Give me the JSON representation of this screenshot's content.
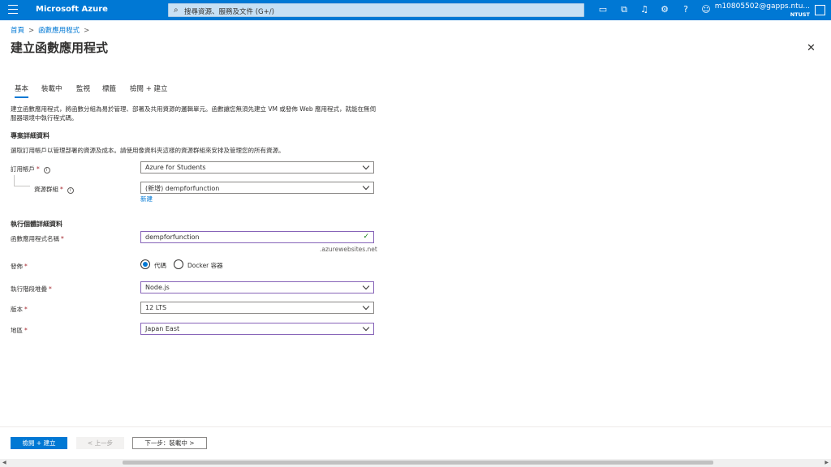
{
  "topbar": {
    "brand": "Microsoft Azure",
    "search_placeholder": "搜尋資源、服務及文件 (G+/)",
    "account_email": "m10805502@gapps.ntu...",
    "account_org": "NTUST"
  },
  "breadcrumb": {
    "home": "首頁",
    "current": "函數應用程式"
  },
  "page_title": "建立函數應用程式",
  "tabs": [
    "基本",
    "裝載中",
    "監視",
    "標籤",
    "檢閱 + 建立"
  ],
  "description": "建立函數應用程式，將函數分組為易於管理、部署及共用資源的邏輯單元。函數讓您無須先建立 VM 或發佈 Web 應用程式，就能在無伺服器環境中執行程式碼。",
  "project": {
    "heading": "專案詳細資料",
    "desc": "選取訂用帳戶以管理部署的資源及成本。請使用像資料夾這樣的資源群組來安排及管理您的所有資源。",
    "subscription_label": "訂用帳戶",
    "subscription_value": "Azure for Students",
    "resource_group_label": "資源群組",
    "resource_group_value": "(新增) dempforfunction",
    "new_link": "新建"
  },
  "instance": {
    "heading": "執行個體詳細資料",
    "name_label": "函數應用程式名稱",
    "name_value": "dempforfunction",
    "name_suffix": ".azurewebsites.net",
    "publish_label": "發佈",
    "publish_option_code": "代碼",
    "publish_option_docker": "Docker 容器",
    "runtime_label": "執行階段堆疊",
    "runtime_value": "Node.js",
    "version_label": "版本",
    "version_value": "12 LTS",
    "region_label": "地區",
    "region_value": "Japan East"
  },
  "footer": {
    "review_button": "檢閱 + 建立",
    "prev_button": "< 上一步",
    "next_button": "下一步：裝載中 >"
  },
  "required_mark": "*",
  "colors": {
    "accent": "#0078d4",
    "selected_border": "#8764b8"
  }
}
